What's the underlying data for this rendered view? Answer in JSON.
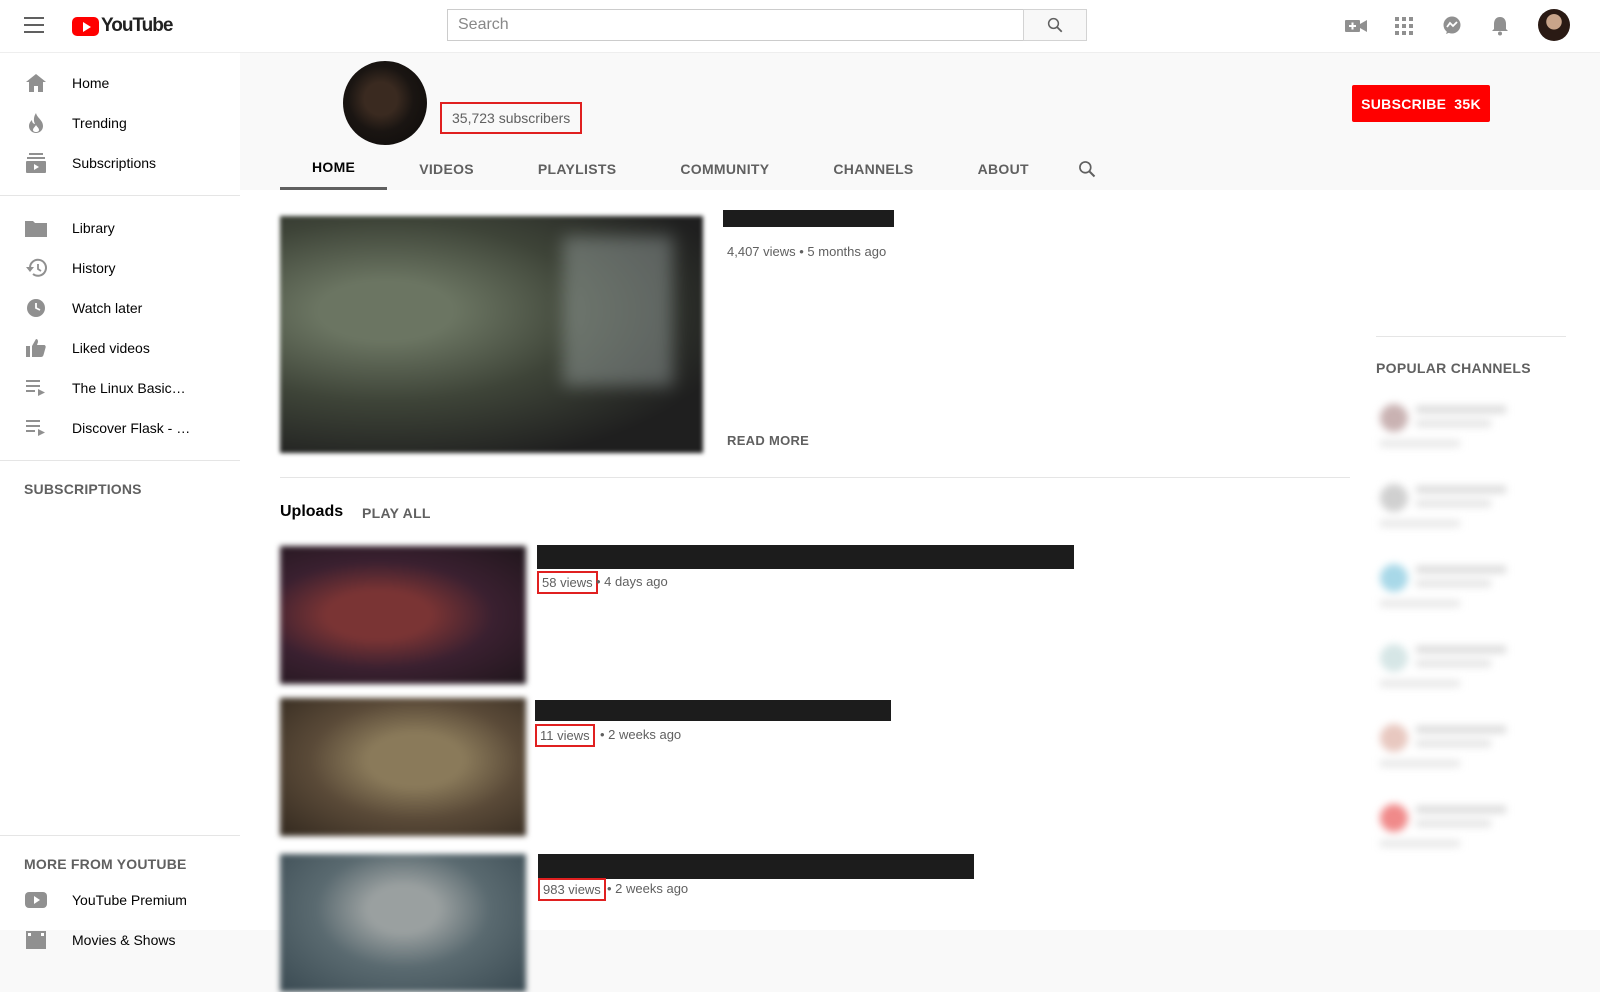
{
  "topbar": {
    "logo_text": "YouTube",
    "search_placeholder": "Search"
  },
  "sidebar": {
    "main_items": [
      {
        "label": "Home",
        "icon": "home-icon"
      },
      {
        "label": "Trending",
        "icon": "fire-icon"
      },
      {
        "label": "Subscriptions",
        "icon": "subscriptions-icon"
      }
    ],
    "library_items": [
      {
        "label": "Library",
        "icon": "folder-icon"
      },
      {
        "label": "History",
        "icon": "history-icon"
      },
      {
        "label": "Watch later",
        "icon": "clock-icon"
      },
      {
        "label": "Liked videos",
        "icon": "thumbs-up-icon"
      },
      {
        "label": "The Linux Basics ...",
        "icon": "playlist-icon"
      },
      {
        "label": "Discover Flask - h...",
        "icon": "playlist-icon"
      }
    ],
    "subscriptions_heading": "SUBSCRIPTIONS",
    "more_heading": "MORE FROM YOUTUBE",
    "more_items": [
      {
        "label": "YouTube Premium",
        "icon": "youtube-icon"
      },
      {
        "label": "Movies & Shows",
        "icon": "film-icon"
      }
    ]
  },
  "channel": {
    "subscribers": "35,723 subscribers",
    "subscribe_label": "SUBSCRIBE",
    "subscribe_count": "35K",
    "tabs": [
      "HOME",
      "VIDEOS",
      "PLAYLISTS",
      "COMMUNITY",
      "CHANNELS",
      "ABOUT"
    ],
    "active_tab": "HOME"
  },
  "featured": {
    "meta": "4,407 views • 5 months ago",
    "read_more": "READ MORE"
  },
  "uploads": {
    "title": "Uploads",
    "play_all": "PLAY ALL",
    "videos": [
      {
        "views": "58 views",
        "age": "• 4 days ago"
      },
      {
        "views": "11 views",
        "age": "• 2 weeks ago"
      },
      {
        "views": "983 views",
        "age": "• 2 weeks ago"
      }
    ]
  },
  "popular": {
    "title": "POPULAR CHANNELS"
  },
  "colors": {
    "brand_red": "#ff0000",
    "highlight_box": "#e02020"
  }
}
